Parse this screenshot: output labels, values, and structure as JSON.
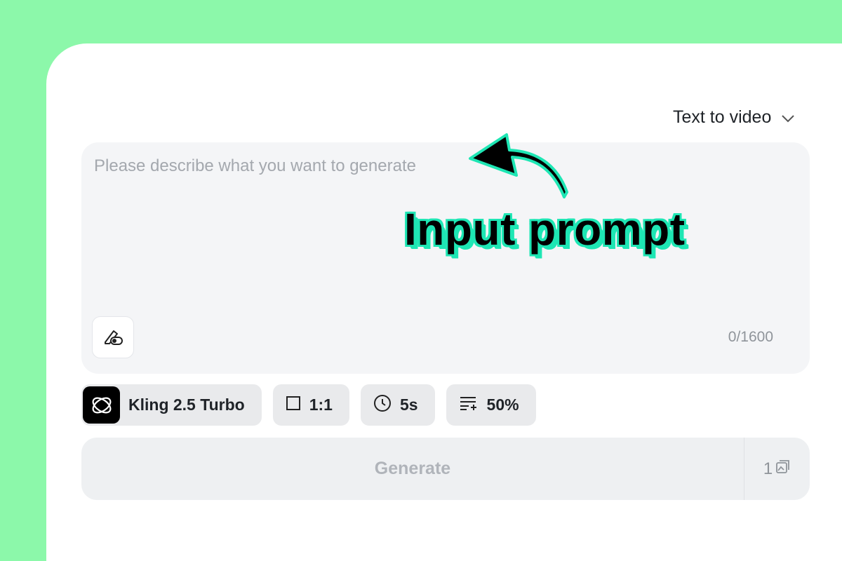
{
  "mode_selector": {
    "label": "Text to video",
    "icon": "chevron-down-icon"
  },
  "prompt": {
    "placeholder": "Please describe what you want to generate",
    "value": "",
    "counter": "0/1600",
    "enhance_icon": "pen-toggle-icon"
  },
  "settings": {
    "model": {
      "label": "Kling 2.5 Turbo",
      "icon": "kling-logo-icon"
    },
    "aspect_ratio": {
      "label": "1:1",
      "icon": "square-icon"
    },
    "duration": {
      "label": "5s",
      "icon": "clock-icon"
    },
    "strength": {
      "label": "50%",
      "icon": "list-sparkle-icon"
    }
  },
  "generate": {
    "label": "Generate",
    "count": "1",
    "count_icon": "image-stack-icon"
  },
  "annotation": {
    "text": "Input prompt",
    "icon": "curved-arrow-icon"
  },
  "colors": {
    "background": "#8cf8aa",
    "panel": "#ffffff",
    "callout_outline": "#1ee6b4",
    "input_bg": "#f4f5f7",
    "chip_bg": "#e9eaec"
  }
}
